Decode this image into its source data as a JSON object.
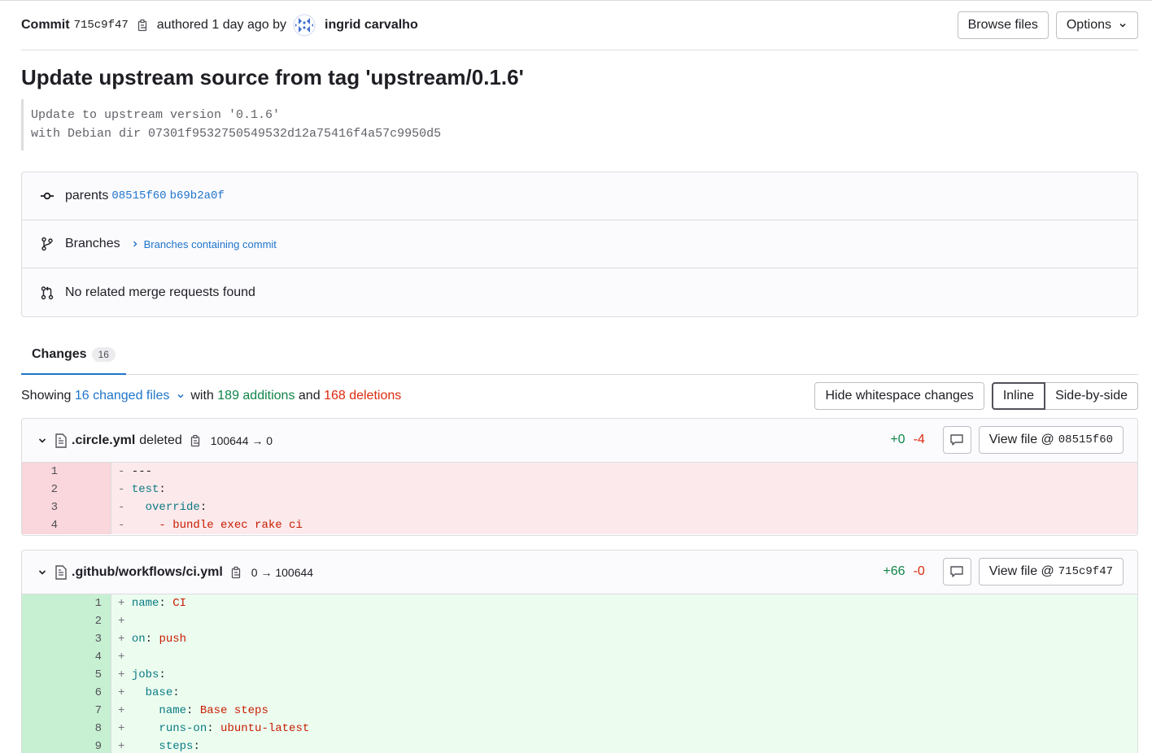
{
  "header": {
    "commit_label": "Commit",
    "sha": "715c9f47",
    "authored_text": "authored 1 day ago by",
    "author": "ingrid carvalho",
    "browse_files": "Browse files",
    "options": "Options"
  },
  "title": "Update upstream source from tag 'upstream/0.1.6'",
  "description": [
    "Update to upstream version '0.1.6'",
    "with Debian dir 07301f9532750549532d12a75416f4a57c9950d5"
  ],
  "info": {
    "parents_label": "parents",
    "parent1": "08515f60",
    "parent2": "b69b2a0f",
    "branches_label": "Branches",
    "branches_link": "Branches containing commit",
    "merge_requests": "No related merge requests found"
  },
  "tabs": {
    "changes_label": "Changes",
    "changes_count": "16"
  },
  "stats": {
    "showing": "Showing",
    "changed_files": "16 changed files",
    "with": "with",
    "additions": "189 additions",
    "and": "and",
    "deletions": "168 deletions",
    "hide_whitespace": "Hide whitespace changes",
    "inline": "Inline",
    "side_by_side": "Side-by-side"
  },
  "files": [
    {
      "name": ".circle.yml",
      "status": "deleted",
      "mode": "100644 → 0",
      "plus": "+0",
      "minus": "-4",
      "view_file": "View file @",
      "view_sha": "08515f60"
    },
    {
      "name": ".github/workflows/ci.yml",
      "status": "",
      "mode": "0 → 100644",
      "plus": "+66",
      "minus": "-0",
      "view_file": "View file @",
      "view_sha": "715c9f47"
    }
  ],
  "colors": {
    "accent": "#1f75cb",
    "addition": "#108548",
    "deletion": "#dd2b0e"
  }
}
